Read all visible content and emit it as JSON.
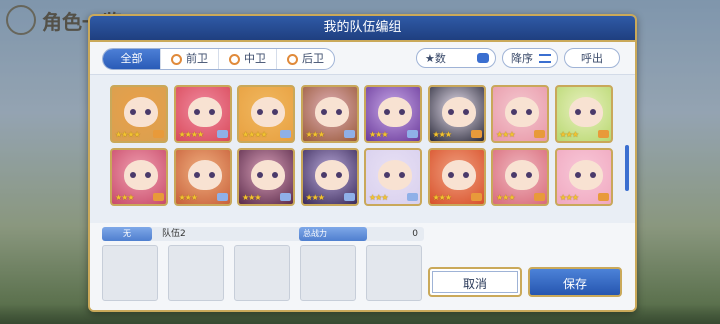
{
  "background": {
    "title": "角色一览"
  },
  "dialog": {
    "title": "我的队伍编组",
    "filters": {
      "tabs": [
        {
          "label": "全部",
          "icon": ""
        },
        {
          "label": "前卫",
          "icon": "front-position-icon"
        },
        {
          "label": "中卫",
          "icon": "middle-position-icon"
        },
        {
          "label": "后卫",
          "icon": "back-position-icon"
        }
      ],
      "star_label": "★数",
      "sort_label": "降序",
      "call_label": "呼出"
    },
    "characters": [
      {
        "stars": 4,
        "bg": "#e9a04a",
        "hair": "#d9a050"
      },
      {
        "stars": 4,
        "bg": "#f08aa0",
        "hair": "#d94a5a"
      },
      {
        "stars": 4,
        "bg": "#f0b860",
        "hair": "#e8a040"
      },
      {
        "stars": 3,
        "bg": "#e0b0b8",
        "hair": "#9a5a3a"
      },
      {
        "stars": 3,
        "bg": "#c8a8e8",
        "hair": "#6a3a9a"
      },
      {
        "stars": 3,
        "bg": "#e8e0ee",
        "hair": "#2a2a3a"
      },
      {
        "stars": 3,
        "bg": "#f4c8d0",
        "hair": "#e898a8"
      },
      {
        "stars": 3,
        "bg": "#e8f0c0",
        "hair": "#b8d870"
      },
      {
        "stars": 3,
        "bg": "#f0a0b0",
        "hair": "#c84a6a"
      },
      {
        "stars": 3,
        "bg": "#f0b080",
        "hair": "#c8603a"
      },
      {
        "stars": 3,
        "bg": "#d8a0b8",
        "hair": "#5a2a4a"
      },
      {
        "stars": 3,
        "bg": "#b8a8d8",
        "hair": "#3a2a5a"
      },
      {
        "stars": 3,
        "bg": "#e8e0f4",
        "hair": "#d8d0ee"
      },
      {
        "stars": 3,
        "bg": "#f0a080",
        "hair": "#d8502a"
      },
      {
        "stars": 3,
        "bg": "#f0b8c0",
        "hair": "#d86a7a"
      },
      {
        "stars": 3,
        "bg": "#f8c8d8",
        "hair": "#f0a8c0"
      }
    ],
    "party": {
      "label": "无",
      "name": "队伍2",
      "power_label": "总战力",
      "power_value": "0"
    },
    "buttons": {
      "cancel": "取消",
      "save": "保存"
    }
  }
}
